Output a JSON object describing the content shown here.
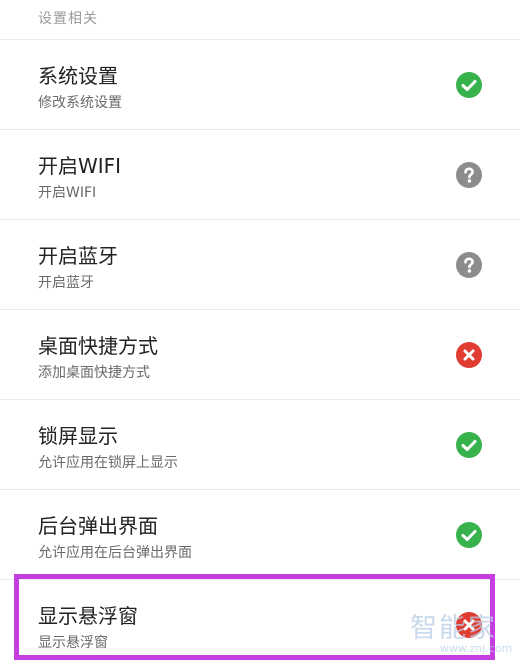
{
  "section": {
    "header": "设置相关"
  },
  "items": [
    {
      "title": "系统设置",
      "subtitle": "修改系统设置",
      "status": "granted",
      "status_icon": "check-icon"
    },
    {
      "title": "开启WIFI",
      "subtitle": "开启WIFI",
      "status": "unknown",
      "status_icon": "question-icon"
    },
    {
      "title": "开启蓝牙",
      "subtitle": "开启蓝牙",
      "status": "unknown",
      "status_icon": "question-icon"
    },
    {
      "title": "桌面快捷方式",
      "subtitle": "添加桌面快捷方式",
      "status": "denied",
      "status_icon": "cross-icon"
    },
    {
      "title": "锁屏显示",
      "subtitle": "允许应用在锁屏上显示",
      "status": "granted",
      "status_icon": "check-icon"
    },
    {
      "title": "后台弹出界面",
      "subtitle": "允许应用在后台弹出界面",
      "status": "granted",
      "status_icon": "check-icon"
    },
    {
      "title": "显示悬浮窗",
      "subtitle": "显示悬浮窗",
      "status": "denied",
      "status_icon": "cross-icon"
    }
  ],
  "watermark": {
    "text": "智能家",
    "url": "www.znj.com"
  },
  "colors": {
    "granted": "#37b24d",
    "unknown": "#8c8c8c",
    "denied": "#e03c31",
    "highlight": "#c43ee0"
  }
}
